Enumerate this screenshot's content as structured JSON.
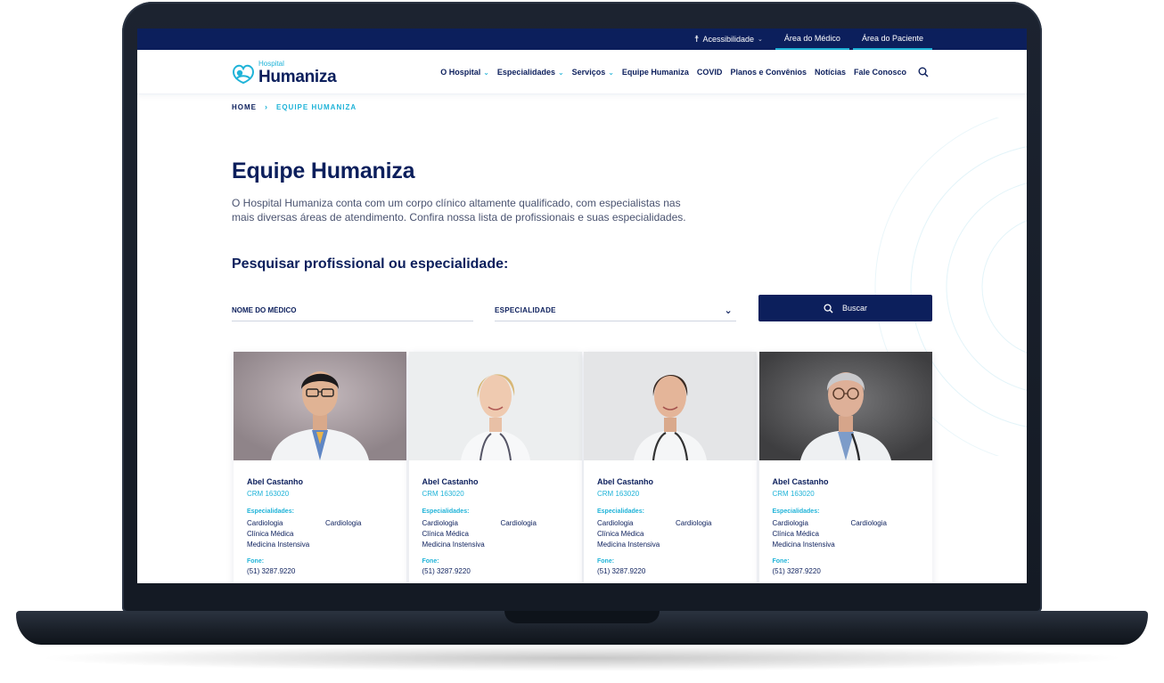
{
  "topbar": {
    "accessibility": "Acessibilidade",
    "tab_doctor": "Área do Médico",
    "tab_patient": "Área do Paciente"
  },
  "logo": {
    "small": "Hospital",
    "big": "Humaniza"
  },
  "nav": {
    "items": [
      {
        "label": "O Hospital",
        "dropdown": true
      },
      {
        "label": "Especialidades",
        "dropdown": true
      },
      {
        "label": "Serviços",
        "dropdown": true
      },
      {
        "label": "Equipe Humaniza",
        "dropdown": false
      },
      {
        "label": "COVID",
        "dropdown": false
      },
      {
        "label": "Planos e Convênios",
        "dropdown": false
      },
      {
        "label": "Notícias",
        "dropdown": false
      },
      {
        "label": "Fale Conosco",
        "dropdown": false
      }
    ]
  },
  "breadcrumb": {
    "home": "HOME",
    "separator": "›",
    "current": "EQUIPE HUMANIZA"
  },
  "page": {
    "title": "Equipe Humaniza",
    "description": "O Hospital Humaniza conta com um corpo clínico altamente qualificado, com especialistas nas mais diversas áreas de atendimento. Confira nossa lista de profissionais e suas especialidades."
  },
  "search": {
    "title": "Pesquisar profissional ou especialidade:",
    "name_placeholder": "NOME DO MÉDICO",
    "specialty_label": "ESPECIALIDADE",
    "button_label": "Buscar"
  },
  "cards": [
    {
      "name": "Abel Castanho",
      "crm": "CRM 163020",
      "spec_label": "Especialidades:",
      "specs_col1": [
        "Cardiologia",
        "Clínica Médica",
        "Medicina Instensiva"
      ],
      "specs_col2": [
        "Cardiologia"
      ],
      "phone_label": "Fone:",
      "phone": "(51) 3287.9220"
    },
    {
      "name": "Abel Castanho",
      "crm": "CRM 163020",
      "spec_label": "Especialidades:",
      "specs_col1": [
        "Cardiologia",
        "Clínica Médica",
        "Medicina Instensiva"
      ],
      "specs_col2": [
        "Cardiologia"
      ],
      "phone_label": "Fone:",
      "phone": "(51) 3287.9220"
    },
    {
      "name": "Abel Castanho",
      "crm": "CRM 163020",
      "spec_label": "Especialidades:",
      "specs_col1": [
        "Cardiologia",
        "Clínica Médica",
        "Medicina Instensiva"
      ],
      "specs_col2": [
        "Cardiologia"
      ],
      "phone_label": "Fone:",
      "phone": "(51) 3287.9220"
    },
    {
      "name": "Abel Castanho",
      "crm": "CRM 163020",
      "spec_label": "Especialidades:",
      "specs_col1": [
        "Cardiologia",
        "Clínica Médica",
        "Medicina Instensiva"
      ],
      "specs_col2": [
        "Cardiologia"
      ],
      "phone_label": "Fone:",
      "phone": "(51) 3287.9220"
    }
  ],
  "colors": {
    "navy": "#0c1f5c",
    "accent": "#1fb3d8"
  },
  "icons": {
    "search": "search-icon",
    "accessibility": "accessibility-icon",
    "chevron": "chevron-down-icon"
  }
}
